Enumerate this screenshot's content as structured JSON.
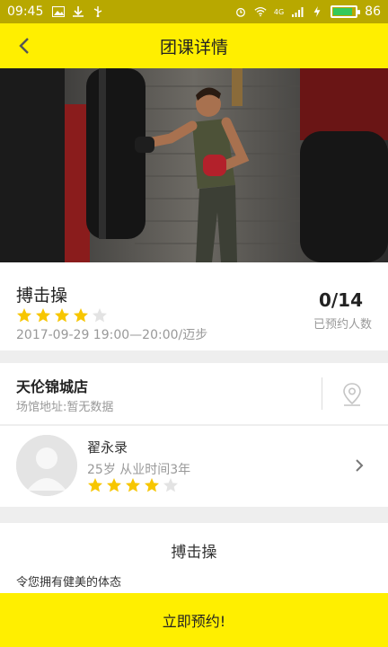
{
  "status_bar": {
    "time": "09:45",
    "network": "4G",
    "battery_level": "86",
    "battery_fraction": 0.86
  },
  "header": {
    "title": "团课详情",
    "back_icon": "back-arrow-icon",
    "background_color": "#ffef00"
  },
  "course": {
    "name": "搏击操",
    "rating": 4,
    "rating_max": 5,
    "time_place": "2017-09-29 19:00—20:00/迈步",
    "booked": "0/14",
    "booked_label": "已预约人数"
  },
  "venue": {
    "name": "天伦锦城店",
    "address": "场馆地址:暂无数据",
    "icon": "location-pin-icon"
  },
  "coach": {
    "name": "翟永录",
    "info": "25岁  从业时间3年",
    "rating": 4,
    "rating_max": 5
  },
  "description": {
    "title": "搏击操",
    "text": "令您拥有健美的体态"
  },
  "booking": {
    "button_label": "立即预约!"
  },
  "colors": {
    "accent": "#ffef00",
    "status_bar": "#b8a800",
    "star_filled": "#f7c600",
    "star_empty": "#e3e3e3"
  }
}
